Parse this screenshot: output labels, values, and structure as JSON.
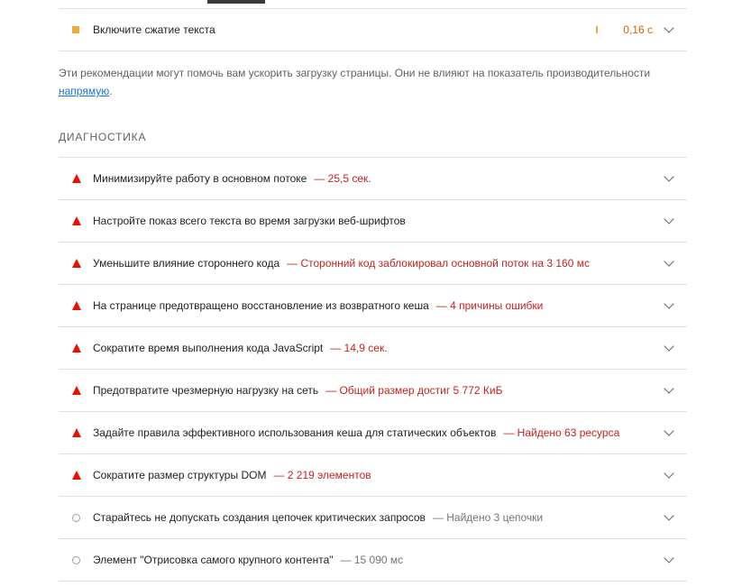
{
  "opportunity": {
    "title": "Включите сжатие текста",
    "value": "0,16 с"
  },
  "note": {
    "text": "Эти рекомендации могут помочь вам ускорить загрузку страницы. Они не влияют на показатель производительности ",
    "link": "напрямую",
    "end": "."
  },
  "diagnostics": {
    "heading": "ДИАГНОСТИКА",
    "items": [
      {
        "title": "Минимизируйте работу в основном потоке",
        "detail": "— 25,5 сек."
      },
      {
        "title": "Настройте показ всего текста во время загрузки веб-шрифтов",
        "detail": ""
      },
      {
        "title": "Уменьшите влияние стороннего кода",
        "detail": "— Сторонний код заблокировал основной поток на 3 160 мс"
      },
      {
        "title": "На странице предотвращено восстановление из возвратного кеша",
        "detail": "— 4 причины ошибки"
      },
      {
        "title": "Сократите время выполнения кода JavaScript",
        "detail": "— 14,9 сек."
      },
      {
        "title": "Предотвратите чрезмерную нагрузку на сеть",
        "detail": "— Общий размер достиг 5 772 КиБ"
      },
      {
        "title": "Задайте правила эффективного использования кеша для статических объектов",
        "detail": "— Найдено 63 ресурса"
      },
      {
        "title": "Сократите размер структуры DOM",
        "detail": "— 2 219 элементов"
      },
      {
        "title": "Старайтесь не допускать создания цепочек критических запросов",
        "detail": "— Найдено 3 цепочки"
      },
      {
        "title": "Элемент \"Отрисовка самого крупного контента\"",
        "detail": "— 15 090 мс"
      }
    ]
  },
  "colors": {
    "fail": "#eb0f00",
    "average": "#f2a93b",
    "info": "#9e9e9e",
    "link": "#1a73e8"
  }
}
